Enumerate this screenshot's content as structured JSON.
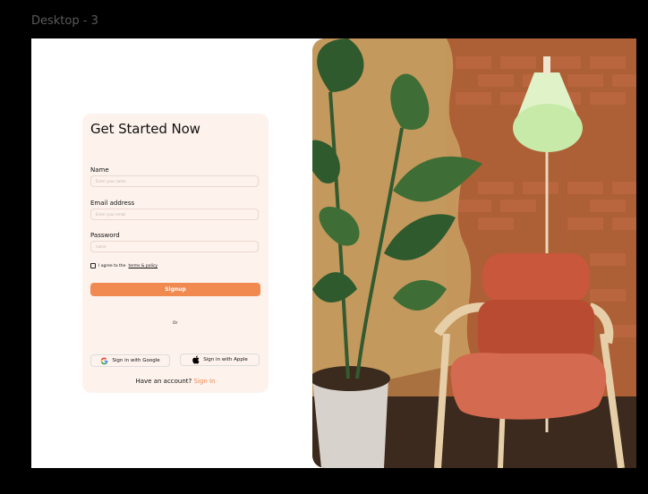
{
  "frame": {
    "label": "Desktop - 3"
  },
  "form": {
    "title": "Get Started Now",
    "name_label": "Name",
    "name_placeholder": "Enter your name",
    "email_label": "Email address",
    "email_placeholder": "Enter your email",
    "password_label": "Password",
    "password_placeholder": "name",
    "agree_prefix": "I agree to the",
    "terms_link": "terms & policy",
    "signup_label": "Signup",
    "or_label": "Or",
    "google_label": "Sign in with Google",
    "apple_label": "Sign in with Apple",
    "account_prompt": "Have an account?",
    "signin_link": "Sign In"
  },
  "colors": {
    "accent": "#f08a50",
    "card_bg": "#fdf2ec"
  },
  "icons": {
    "google": "google-icon",
    "apple": "apple-icon"
  }
}
